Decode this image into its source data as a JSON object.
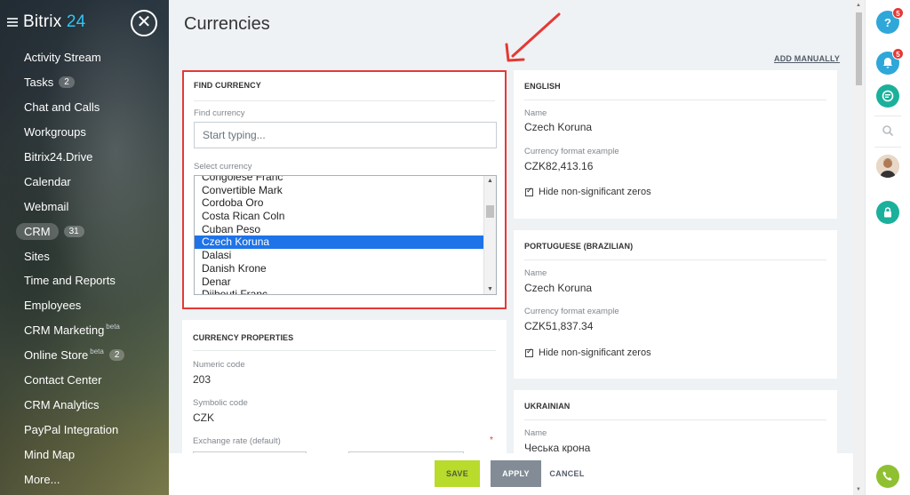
{
  "sidebar": {
    "logo_main": "Bitrix",
    "logo_num": "24",
    "close_symbol": "✕",
    "items": [
      {
        "label": "Activity Stream",
        "counter": "",
        "beta": ""
      },
      {
        "label": "Tasks",
        "counter": "2",
        "beta": ""
      },
      {
        "label": "Chat and Calls",
        "counter": "",
        "beta": ""
      },
      {
        "label": "Workgroups",
        "counter": "",
        "beta": ""
      },
      {
        "label": "Bitrix24.Drive",
        "counter": "",
        "beta": ""
      },
      {
        "label": "Calendar",
        "counter": "",
        "beta": ""
      },
      {
        "label": "Webmail",
        "counter": "",
        "beta": ""
      },
      {
        "label": "CRM",
        "counter": "31",
        "beta": ""
      },
      {
        "label": "Sites",
        "counter": "",
        "beta": ""
      },
      {
        "label": "Time and Reports",
        "counter": "",
        "beta": ""
      },
      {
        "label": "Employees",
        "counter": "",
        "beta": ""
      },
      {
        "label": "CRM Marketing",
        "counter": "",
        "beta": "beta"
      },
      {
        "label": "Online Store",
        "counter": "2",
        "beta": "beta"
      },
      {
        "label": "Contact Center",
        "counter": "",
        "beta": ""
      },
      {
        "label": "CRM Analytics",
        "counter": "",
        "beta": ""
      },
      {
        "label": "PayPal Integration",
        "counter": "",
        "beta": ""
      },
      {
        "label": "Mind Map",
        "counter": "",
        "beta": ""
      },
      {
        "label": "More...",
        "counter": "",
        "beta": ""
      }
    ]
  },
  "page": {
    "title": "Currencies",
    "add_manually": "ADD MANUALLY"
  },
  "find": {
    "title": "FIND CURRENCY",
    "find_label": "Find currency",
    "placeholder": "Start typing...",
    "select_label": "Select currency",
    "options": [
      "Congolese Franc",
      "Convertible Mark",
      "Cordoba Oro",
      "Costa Rican Coln",
      "Cuban Peso",
      "Czech Koruna",
      "Dalasi",
      "Danish Krone",
      "Denar",
      "Djibouti Franc"
    ],
    "selected": "Czech Koruna"
  },
  "props": {
    "title": "CURRENCY PROPERTIES",
    "numeric_label": "Numeric code",
    "numeric_value": "203",
    "symbolic_label": "Symbolic code",
    "symbolic_value": "CZK",
    "rate_label": "Exchange rate (default)",
    "required_mark": "*"
  },
  "languages": [
    {
      "title": "ENGLISH",
      "name_label": "Name",
      "name": "Czech Koruna",
      "format_label": "Currency format example",
      "format": "CZK82,413.16",
      "checkbox": "Hide non-significant zeros"
    },
    {
      "title": "PORTUGUESE (BRAZILIAN)",
      "name_label": "Name",
      "name": "Czech Koruna",
      "format_label": "Currency format example",
      "format": "CZK51,837.34",
      "checkbox": "Hide non-significant zeros"
    },
    {
      "title": "UKRAINIAN",
      "name_label": "Name",
      "name": "Чеська крона"
    }
  ],
  "footer": {
    "save": "SAVE",
    "apply": "APPLY",
    "cancel": "CANCEL"
  },
  "rightbar": {
    "help_symbol": "?",
    "help_badge": "5",
    "notify_badge": "5"
  },
  "colors": {
    "accent_blue": "#1e73e8",
    "save_green": "#b8db2c",
    "annotation_red": "#e53935"
  }
}
